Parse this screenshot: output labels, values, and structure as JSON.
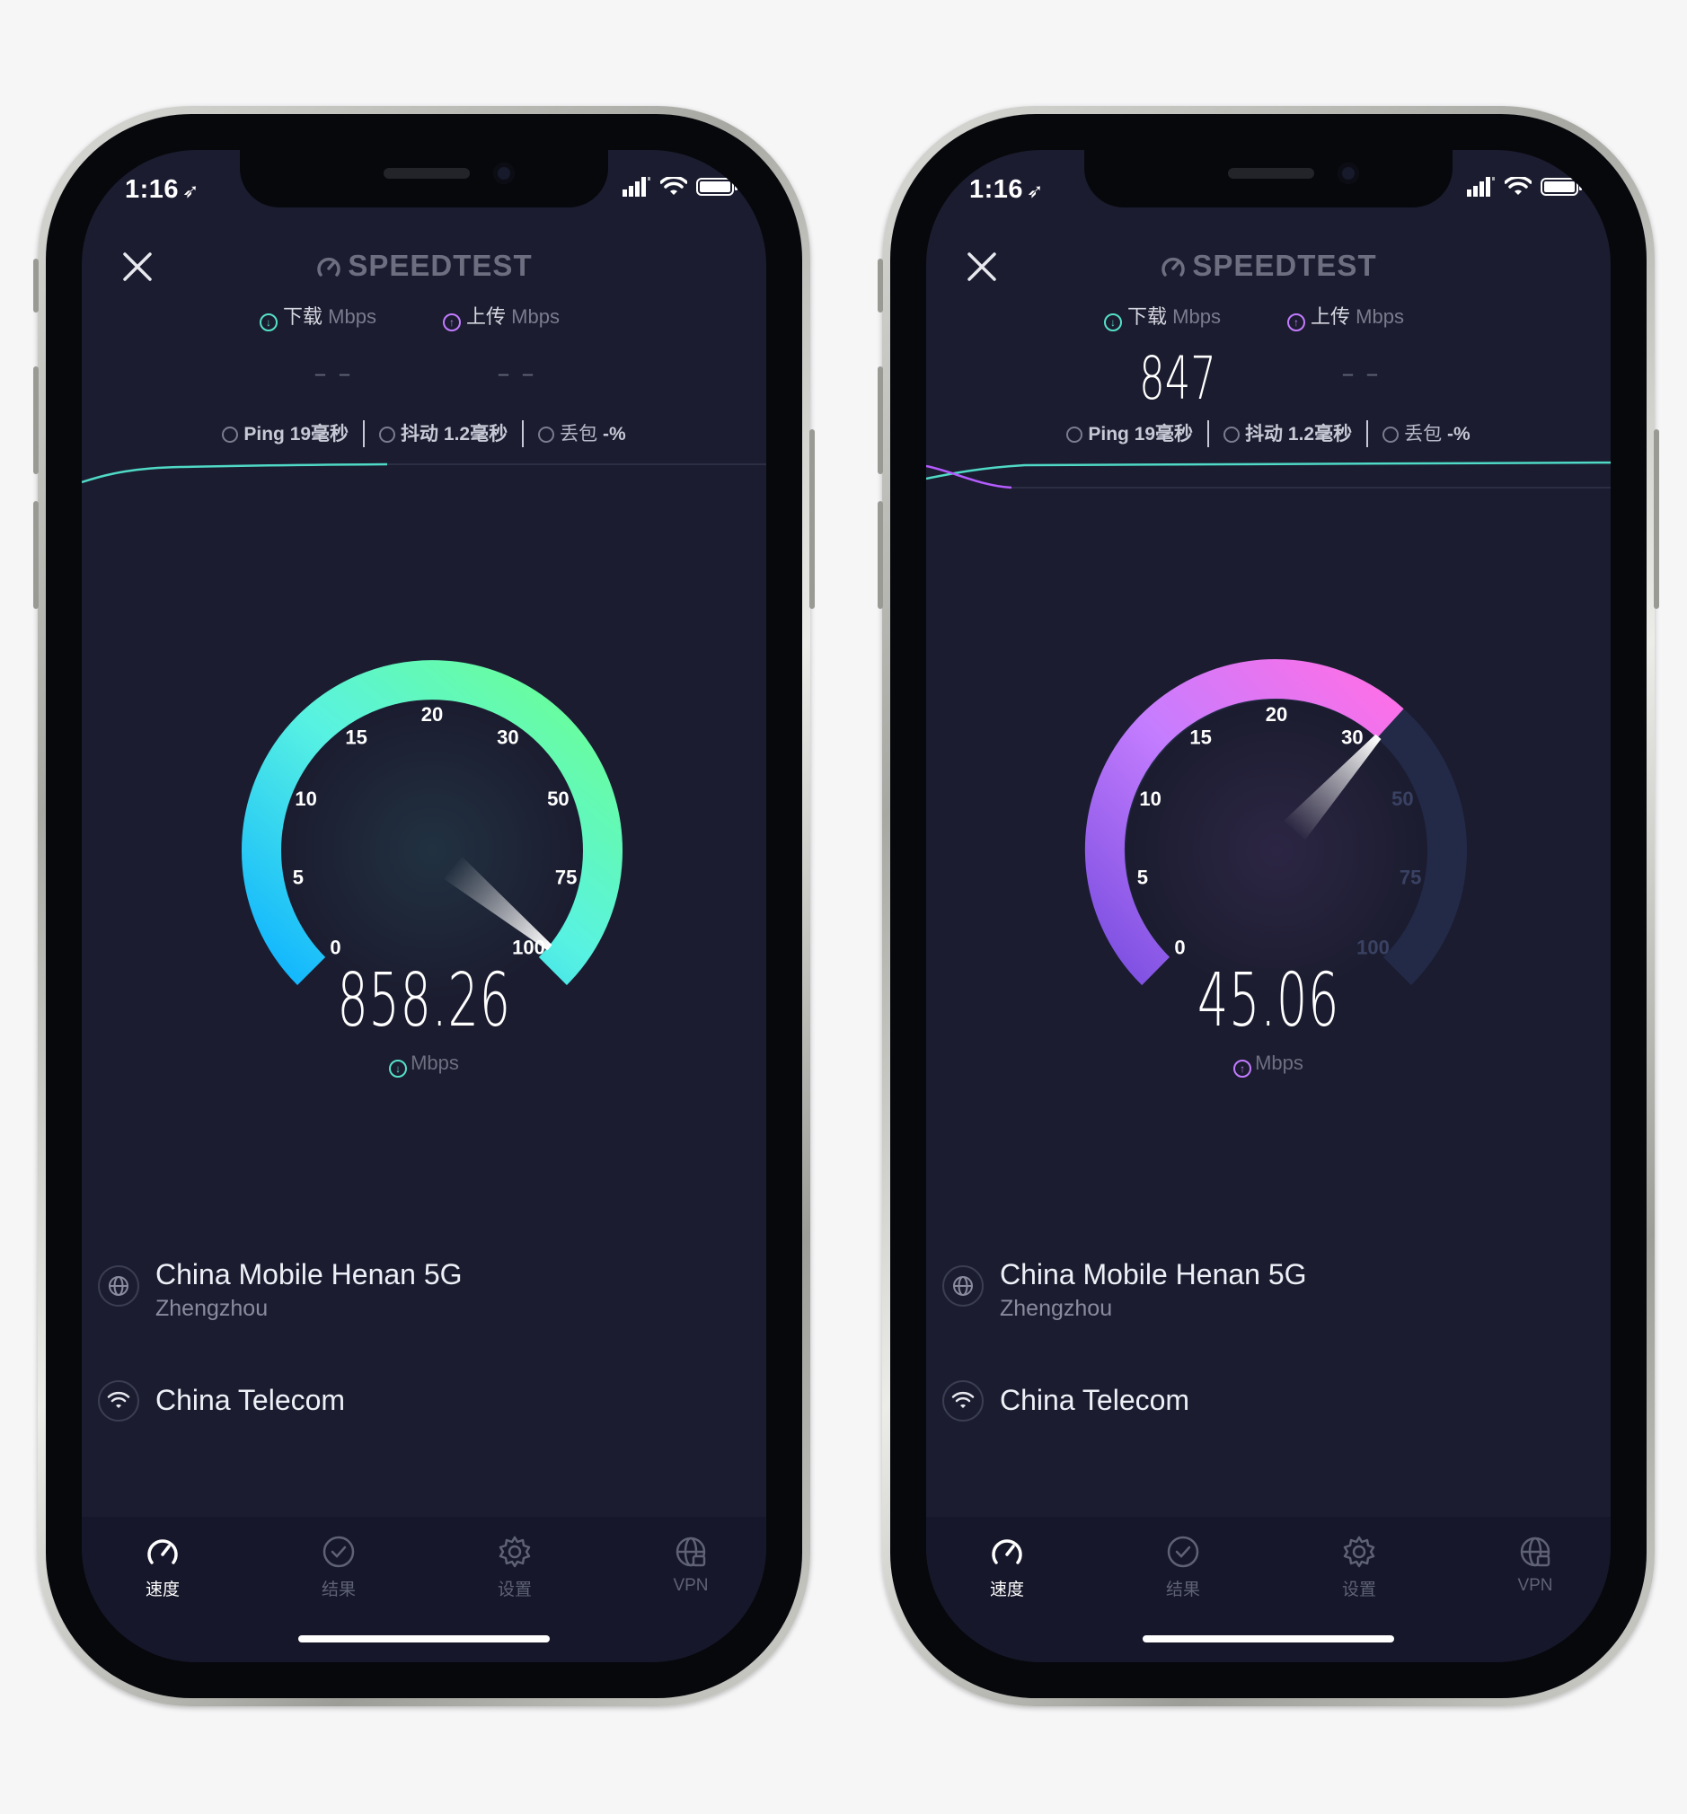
{
  "phones": [
    {
      "status": {
        "time": "1:16",
        "arrow": "➶"
      },
      "brand": "SPEEDTEST",
      "download": {
        "label": "下载",
        "unit": "Mbps",
        "value": "– –"
      },
      "upload": {
        "label": "上传",
        "unit": "Mbps",
        "value": "– –"
      },
      "stats": {
        "ping_label": "Ping",
        "ping_value": "19毫秒",
        "jitter_label": "抖动",
        "jitter_value": "1.2毫秒",
        "loss_label": "丢包",
        "loss_value": "-%"
      },
      "gauge": {
        "mode": "download",
        "ticks": [
          "0",
          "5",
          "10",
          "15",
          "20",
          "30",
          "50",
          "75",
          "100"
        ],
        "speed": "858.26",
        "unit": "Mbps",
        "needle_fraction": 0.98,
        "fill_fraction": 1.0,
        "colors": {
          "start": "#0fb4ff",
          "mid": "#58f2e2",
          "end": "#6dff8e"
        }
      },
      "server": {
        "name": "China Mobile Henan 5G",
        "city": "Zhengzhou"
      },
      "isp": {
        "name": "China Telecom"
      },
      "tabs": [
        {
          "label": "速度",
          "icon": "speed-gauge-icon",
          "active": true
        },
        {
          "label": "结果",
          "icon": "check-circle-icon",
          "active": false
        },
        {
          "label": "设置",
          "icon": "gear-icon",
          "active": false
        },
        {
          "label": "VPN",
          "icon": "vpn-globe-icon",
          "active": false
        }
      ]
    },
    {
      "status": {
        "time": "1:16",
        "arrow": "➶"
      },
      "brand": "SPEEDTEST",
      "download": {
        "label": "下载",
        "unit": "Mbps",
        "value": "847"
      },
      "upload": {
        "label": "上传",
        "unit": "Mbps",
        "value": "– –"
      },
      "stats": {
        "ping_label": "Ping",
        "ping_value": "19毫秒",
        "jitter_label": "抖动",
        "jitter_value": "1.2毫秒",
        "loss_label": "丢包",
        "loss_value": "-%"
      },
      "gauge": {
        "mode": "upload",
        "ticks": [
          "0",
          "5",
          "10",
          "15",
          "20",
          "30",
          "50",
          "75",
          "100"
        ],
        "speed": "45.06",
        "unit": "Mbps",
        "needle_fraction": 0.655,
        "fill_fraction": 0.655,
        "colors": {
          "start": "#7a4ee0",
          "mid": "#c57dff",
          "end": "#ff6fe6"
        }
      },
      "server": {
        "name": "China Mobile Henan 5G",
        "city": "Zhengzhou"
      },
      "isp": {
        "name": "China Telecom"
      },
      "tabs": [
        {
          "label": "速度",
          "icon": "speed-gauge-icon",
          "active": true
        },
        {
          "label": "结果",
          "icon": "check-circle-icon",
          "active": false
        },
        {
          "label": "设置",
          "icon": "gear-icon",
          "active": false
        },
        {
          "label": "VPN",
          "icon": "vpn-globe-icon",
          "active": false
        }
      ]
    }
  ]
}
